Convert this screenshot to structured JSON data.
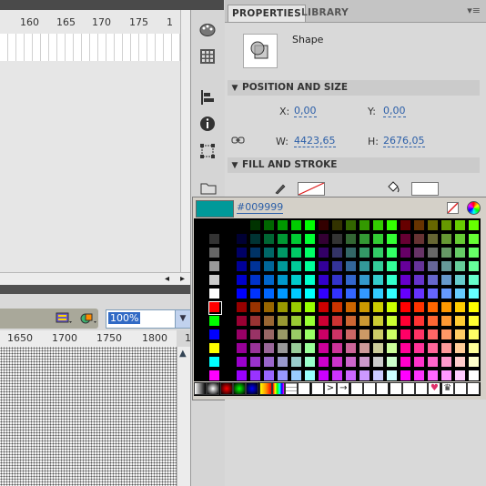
{
  "timeline": {
    "frame_numbers": [
      "160",
      "165",
      "170",
      "175",
      "1"
    ],
    "scroll_left_arrow": "◂",
    "scroll_right_arrow": "▸"
  },
  "stage": {
    "zoom_value": "100%",
    "ruler_numbers": [
      "1650",
      "1700",
      "1750",
      "1800",
      "1"
    ]
  },
  "icon_strip": {
    "icons": [
      "palette-icon",
      "swatches-grid-icon",
      "align-icon",
      "info-icon",
      "transform-icon",
      "motion-presets-icon"
    ]
  },
  "properties": {
    "tabs": [
      "PROPERTIES",
      "LIBRARY"
    ],
    "menu_glyph": "▾≡",
    "object_type": "Shape",
    "position_size": {
      "title": "POSITION AND SIZE",
      "x_label": "X:",
      "x_value": "0,00",
      "y_label": "Y:",
      "y_value": "0,00",
      "w_label": "W:",
      "w_value": "4423,65",
      "h_label": "H:",
      "h_value": "2676,05"
    },
    "fill_stroke": {
      "title": "FILL AND STROKE"
    }
  },
  "color_picker": {
    "hex_value": "#009999",
    "preview_color": "#009999"
  }
}
